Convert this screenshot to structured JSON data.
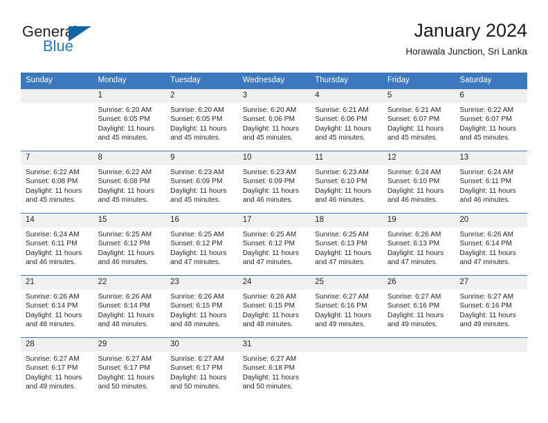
{
  "brand": {
    "name_top": "General",
    "name_bottom": "Blue",
    "triangle_color": "#1064a8",
    "blue_color": "#1f7ac4"
  },
  "header": {
    "title": "January 2024",
    "subtitle": "Horawala Junction, Sri Lanka"
  },
  "theme": {
    "header_row_bg": "#3b78be",
    "day_number_bg": "#f0f0f0",
    "text_color": "#231f20"
  },
  "weekday_headers": [
    "Sunday",
    "Monday",
    "Tuesday",
    "Wednesday",
    "Thursday",
    "Friday",
    "Saturday"
  ],
  "weeks": [
    [
      {
        "day": "",
        "empty": true,
        "sunrise": "",
        "sunset": "",
        "daylight_line1": "",
        "daylight_line2": ""
      },
      {
        "day": "1",
        "sunrise": "Sunrise: 6:20 AM",
        "sunset": "Sunset: 6:05 PM",
        "daylight_line1": "Daylight: 11 hours",
        "daylight_line2": "and 45 minutes."
      },
      {
        "day": "2",
        "sunrise": "Sunrise: 6:20 AM",
        "sunset": "Sunset: 6:05 PM",
        "daylight_line1": "Daylight: 11 hours",
        "daylight_line2": "and 45 minutes."
      },
      {
        "day": "3",
        "sunrise": "Sunrise: 6:20 AM",
        "sunset": "Sunset: 6:06 PM",
        "daylight_line1": "Daylight: 11 hours",
        "daylight_line2": "and 45 minutes."
      },
      {
        "day": "4",
        "sunrise": "Sunrise: 6:21 AM",
        "sunset": "Sunset: 6:06 PM",
        "daylight_line1": "Daylight: 11 hours",
        "daylight_line2": "and 45 minutes."
      },
      {
        "day": "5",
        "sunrise": "Sunrise: 6:21 AM",
        "sunset": "Sunset: 6:07 PM",
        "daylight_line1": "Daylight: 11 hours",
        "daylight_line2": "and 45 minutes."
      },
      {
        "day": "6",
        "sunrise": "Sunrise: 6:22 AM",
        "sunset": "Sunset: 6:07 PM",
        "daylight_line1": "Daylight: 11 hours",
        "daylight_line2": "and 45 minutes."
      }
    ],
    [
      {
        "day": "7",
        "sunrise": "Sunrise: 6:22 AM",
        "sunset": "Sunset: 6:08 PM",
        "daylight_line1": "Daylight: 11 hours",
        "daylight_line2": "and 45 minutes."
      },
      {
        "day": "8",
        "sunrise": "Sunrise: 6:22 AM",
        "sunset": "Sunset: 6:08 PM",
        "daylight_line1": "Daylight: 11 hours",
        "daylight_line2": "and 45 minutes."
      },
      {
        "day": "9",
        "sunrise": "Sunrise: 6:23 AM",
        "sunset": "Sunset: 6:09 PM",
        "daylight_line1": "Daylight: 11 hours",
        "daylight_line2": "and 45 minutes."
      },
      {
        "day": "10",
        "sunrise": "Sunrise: 6:23 AM",
        "sunset": "Sunset: 6:09 PM",
        "daylight_line1": "Daylight: 11 hours",
        "daylight_line2": "and 46 minutes."
      },
      {
        "day": "11",
        "sunrise": "Sunrise: 6:23 AM",
        "sunset": "Sunset: 6:10 PM",
        "daylight_line1": "Daylight: 11 hours",
        "daylight_line2": "and 46 minutes."
      },
      {
        "day": "12",
        "sunrise": "Sunrise: 6:24 AM",
        "sunset": "Sunset: 6:10 PM",
        "daylight_line1": "Daylight: 11 hours",
        "daylight_line2": "and 46 minutes."
      },
      {
        "day": "13",
        "sunrise": "Sunrise: 6:24 AM",
        "sunset": "Sunset: 6:11 PM",
        "daylight_line1": "Daylight: 11 hours",
        "daylight_line2": "and 46 minutes."
      }
    ],
    [
      {
        "day": "14",
        "sunrise": "Sunrise: 6:24 AM",
        "sunset": "Sunset: 6:11 PM",
        "daylight_line1": "Daylight: 11 hours",
        "daylight_line2": "and 46 minutes."
      },
      {
        "day": "15",
        "sunrise": "Sunrise: 6:25 AM",
        "sunset": "Sunset: 6:12 PM",
        "daylight_line1": "Daylight: 11 hours",
        "daylight_line2": "and 46 minutes."
      },
      {
        "day": "16",
        "sunrise": "Sunrise: 6:25 AM",
        "sunset": "Sunset: 6:12 PM",
        "daylight_line1": "Daylight: 11 hours",
        "daylight_line2": "and 47 minutes."
      },
      {
        "day": "17",
        "sunrise": "Sunrise: 6:25 AM",
        "sunset": "Sunset: 6:12 PM",
        "daylight_line1": "Daylight: 11 hours",
        "daylight_line2": "and 47 minutes."
      },
      {
        "day": "18",
        "sunrise": "Sunrise: 6:25 AM",
        "sunset": "Sunset: 6:13 PM",
        "daylight_line1": "Daylight: 11 hours",
        "daylight_line2": "and 47 minutes."
      },
      {
        "day": "19",
        "sunrise": "Sunrise: 6:26 AM",
        "sunset": "Sunset: 6:13 PM",
        "daylight_line1": "Daylight: 11 hours",
        "daylight_line2": "and 47 minutes."
      },
      {
        "day": "20",
        "sunrise": "Sunrise: 6:26 AM",
        "sunset": "Sunset: 6:14 PM",
        "daylight_line1": "Daylight: 11 hours",
        "daylight_line2": "and 47 minutes."
      }
    ],
    [
      {
        "day": "21",
        "sunrise": "Sunrise: 6:26 AM",
        "sunset": "Sunset: 6:14 PM",
        "daylight_line1": "Daylight: 11 hours",
        "daylight_line2": "and 48 minutes."
      },
      {
        "day": "22",
        "sunrise": "Sunrise: 6:26 AM",
        "sunset": "Sunset: 6:14 PM",
        "daylight_line1": "Daylight: 11 hours",
        "daylight_line2": "and 48 minutes."
      },
      {
        "day": "23",
        "sunrise": "Sunrise: 6:26 AM",
        "sunset": "Sunset: 6:15 PM",
        "daylight_line1": "Daylight: 11 hours",
        "daylight_line2": "and 48 minutes."
      },
      {
        "day": "24",
        "sunrise": "Sunrise: 6:26 AM",
        "sunset": "Sunset: 6:15 PM",
        "daylight_line1": "Daylight: 11 hours",
        "daylight_line2": "and 48 minutes."
      },
      {
        "day": "25",
        "sunrise": "Sunrise: 6:27 AM",
        "sunset": "Sunset: 6:16 PM",
        "daylight_line1": "Daylight: 11 hours",
        "daylight_line2": "and 49 minutes."
      },
      {
        "day": "26",
        "sunrise": "Sunrise: 6:27 AM",
        "sunset": "Sunset: 6:16 PM",
        "daylight_line1": "Daylight: 11 hours",
        "daylight_line2": "and 49 minutes."
      },
      {
        "day": "27",
        "sunrise": "Sunrise: 6:27 AM",
        "sunset": "Sunset: 6:16 PM",
        "daylight_line1": "Daylight: 11 hours",
        "daylight_line2": "and 49 minutes."
      }
    ],
    [
      {
        "day": "28",
        "sunrise": "Sunrise: 6:27 AM",
        "sunset": "Sunset: 6:17 PM",
        "daylight_line1": "Daylight: 11 hours",
        "daylight_line2": "and 49 minutes."
      },
      {
        "day": "29",
        "sunrise": "Sunrise: 6:27 AM",
        "sunset": "Sunset: 6:17 PM",
        "daylight_line1": "Daylight: 11 hours",
        "daylight_line2": "and 50 minutes."
      },
      {
        "day": "30",
        "sunrise": "Sunrise: 6:27 AM",
        "sunset": "Sunset: 6:17 PM",
        "daylight_line1": "Daylight: 11 hours",
        "daylight_line2": "and 50 minutes."
      },
      {
        "day": "31",
        "sunrise": "Sunrise: 6:27 AM",
        "sunset": "Sunset: 6:18 PM",
        "daylight_line1": "Daylight: 11 hours",
        "daylight_line2": "and 50 minutes."
      },
      {
        "day": "",
        "empty": true,
        "sunrise": "",
        "sunset": "",
        "daylight_line1": "",
        "daylight_line2": ""
      },
      {
        "day": "",
        "empty": true,
        "sunrise": "",
        "sunset": "",
        "daylight_line1": "",
        "daylight_line2": ""
      },
      {
        "day": "",
        "empty": true,
        "sunrise": "",
        "sunset": "",
        "daylight_line1": "",
        "daylight_line2": ""
      }
    ]
  ]
}
